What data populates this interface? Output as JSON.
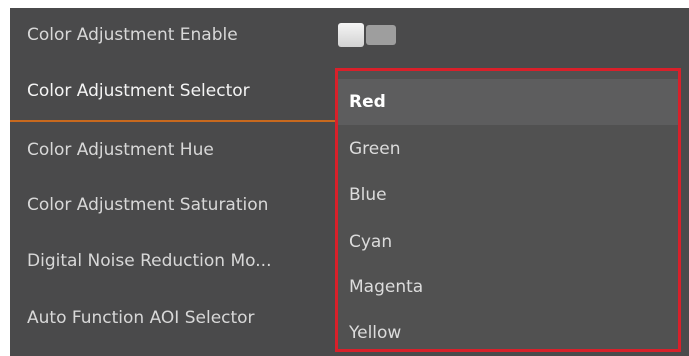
{
  "properties": [
    {
      "label": "Color Adjustment Enable"
    },
    {
      "label": "Color Adjustment Selector"
    },
    {
      "label": "Color Adjustment Hue"
    },
    {
      "label": "Color Adjustment Saturation"
    },
    {
      "label": "Digital Noise Reduction Mo..."
    },
    {
      "label": "Auto Function AOI Selector"
    }
  ],
  "color_adjustment_enable": {
    "state": "off"
  },
  "color_selector": {
    "selected": "Red",
    "options": [
      "Red",
      "Green",
      "Blue",
      "Cyan",
      "Magenta",
      "Yellow"
    ]
  },
  "colors": {
    "panel_bg": "#4a4a4b",
    "highlight_divider": "#c8691e",
    "dropdown_border": "#d9202a"
  }
}
